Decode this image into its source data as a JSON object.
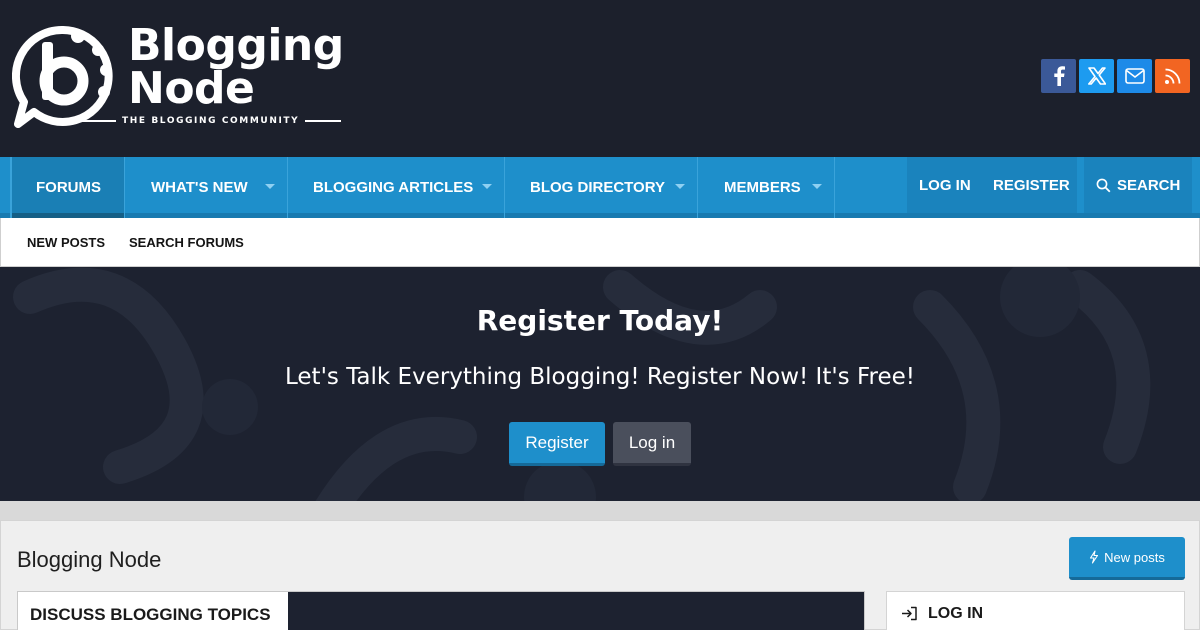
{
  "header": {
    "logo_line1": "Blogging",
    "logo_line2": "Node",
    "logo_tagline": "THE BLOGGING COMMUNITY",
    "social": [
      {
        "icon": "facebook-icon",
        "color": "#3b5998"
      },
      {
        "icon": "x-icon",
        "color": "#1d9bf0"
      },
      {
        "icon": "envelope-icon",
        "color": "#1d8ae8"
      },
      {
        "icon": "rss-icon",
        "color": "#f26522"
      }
    ]
  },
  "nav": {
    "items": [
      {
        "label": "FORUMS",
        "active": true
      },
      {
        "label": "WHAT'S NEW",
        "has_dropdown": true
      },
      {
        "label": "BLOGGING ARTICLES",
        "has_dropdown": true
      },
      {
        "label": "BLOG DIRECTORY",
        "has_dropdown": true
      },
      {
        "label": "MEMBERS",
        "has_dropdown": true
      }
    ],
    "login": "LOG IN",
    "register": "REGISTER",
    "search": "SEARCH"
  },
  "subnav": {
    "items": [
      "NEW POSTS",
      "SEARCH FORUMS"
    ]
  },
  "hero": {
    "title": "Register Today!",
    "subtitle": "Let's Talk Everything Blogging! Register Now! It's Free!",
    "register_button": "Register",
    "login_button": "Log in"
  },
  "content": {
    "page_title": "Blogging Node",
    "new_posts_button": "New posts",
    "discuss_tab": "DISCUSS BLOGGING TOPICS",
    "sidebar_login": "LOG IN"
  },
  "colors": {
    "header_bg": "#1c202c",
    "nav_bg": "#1e8fcb",
    "accent": "#1e8fcb"
  }
}
